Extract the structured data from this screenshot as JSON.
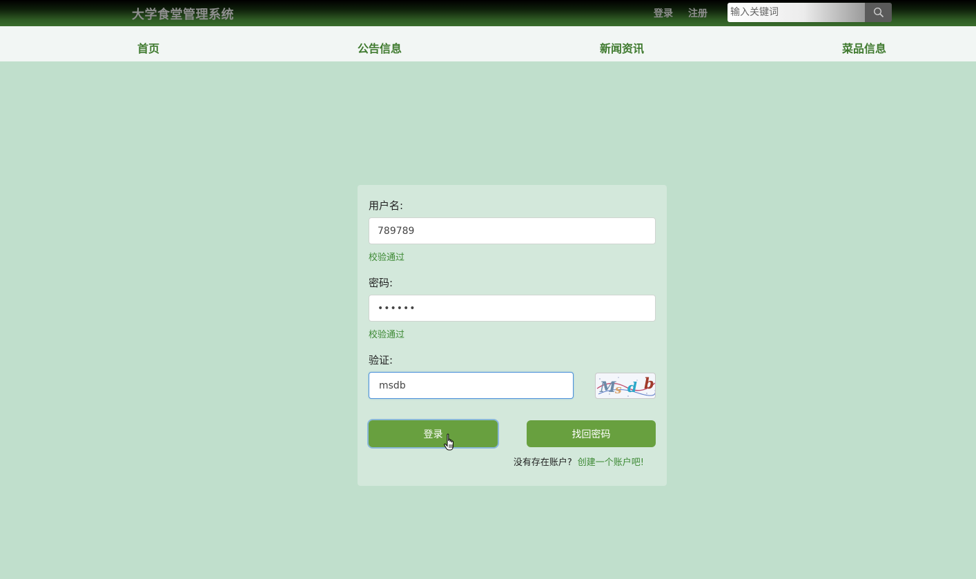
{
  "header": {
    "brand": "大学食堂管理系统",
    "login_link": "登录",
    "register_link": "注册",
    "search_placeholder": "输入关键词"
  },
  "nav": {
    "items": [
      {
        "label": "首页"
      },
      {
        "label": "公告信息"
      },
      {
        "label": "新闻资讯"
      },
      {
        "label": "菜品信息"
      }
    ]
  },
  "form": {
    "username_label": "用户名:",
    "username_value": "789789",
    "username_msg": "校验通过",
    "password_label": "密码:",
    "password_value": "••••••",
    "password_msg": "校验通过",
    "captcha_label": "验证:",
    "captcha_value": "msdb",
    "captcha_text": "Msdb",
    "login_button": "登录",
    "recover_button": "找回密码",
    "no_account_text": "没有存在账户?",
    "create_account_link": "创建一个账户吧!"
  },
  "colors": {
    "page_bg": "#c0dfcc",
    "accent": "#68a03f",
    "nav_text": "#3f7a2e",
    "success": "#3e8a35"
  }
}
